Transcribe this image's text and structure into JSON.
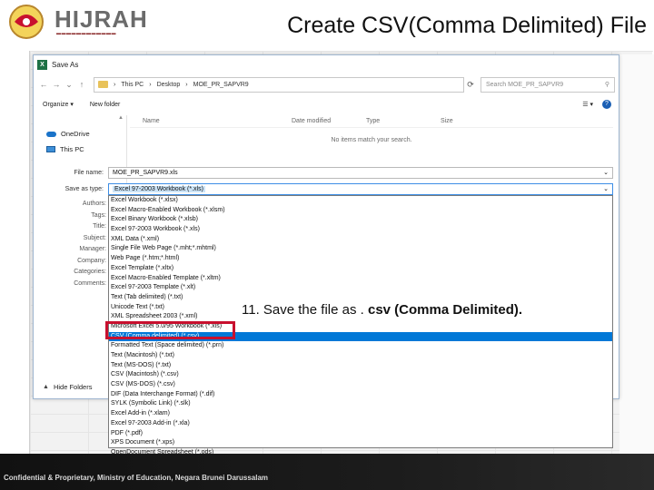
{
  "slide": {
    "title": "Create CSV(Comma Delimited) File",
    "logo_text": "HIJRAH",
    "footer": "Confidential & Proprietary, Ministry of Education, Negara Brunei Darussalam",
    "callout_prefix": "11. Save the file as . ",
    "callout_bold": "csv (Comma Delimited)."
  },
  "dialog": {
    "title": "Save As",
    "breadcrumb": [
      "This PC",
      "Desktop",
      "MOE_PR_SAPVR9"
    ],
    "search_placeholder": "Search MOE_PR_SAPVR9",
    "toolbar": {
      "organize": "Organize",
      "new_folder": "New folder"
    },
    "nav_items": [
      "OneDrive",
      "This PC"
    ],
    "columns": [
      "Name",
      "Date modified",
      "Type",
      "Size"
    ],
    "empty_message": "No items match your search.",
    "file_name_label": "File name:",
    "file_name_value": "MOE_PR_SAPVR9.xls",
    "save_type_label": "Save as type:",
    "save_type_value": "Excel 97-2003 Workbook (*.xls)",
    "meta_labels": [
      "Authors:",
      "Tags:",
      "Title:",
      "Subject:",
      "Manager:",
      "Company:",
      "Categories:",
      "Comments:"
    ],
    "hide_folders": "Hide Folders"
  },
  "dropdown_options": [
    "Excel Workbook (*.xlsx)",
    "Excel Macro-Enabled Workbook (*.xlsm)",
    "Excel Binary Workbook (*.xlsb)",
    "Excel 97-2003 Workbook (*.xls)",
    "XML Data (*.xml)",
    "Single File Web Page (*.mht;*.mhtml)",
    "Web Page (*.htm;*.html)",
    "Excel Template (*.xltx)",
    "Excel Macro-Enabled Template (*.xltm)",
    "Excel 97-2003 Template (*.xlt)",
    "Text (Tab delimited) (*.txt)",
    "Unicode Text (*.txt)",
    "XML Spreadsheet 2003 (*.xml)",
    "Microsoft Excel 5.0/95 Workbook (*.xls)",
    "CSV (Comma delimited) (*.csv)",
    "Formatted Text (Space delimited) (*.prn)",
    "Text (Macintosh) (*.txt)",
    "Text (MS-DOS) (*.txt)",
    "CSV (Macintosh) (*.csv)",
    "CSV (MS-DOS) (*.csv)",
    "DIF (Data Interchange Format) (*.dif)",
    "SYLK (Symbolic Link) (*.slk)",
    "Excel Add-in (*.xlam)",
    "Excel 97-2003 Add-in (*.xla)",
    "PDF (*.pdf)",
    "XPS Document (*.xps)",
    "OpenDocument Spreadsheet (*.ods)"
  ],
  "highlighted_option_index": 14,
  "colors": {
    "highlight": "#0078d7",
    "callout_box": "#c8102e",
    "footer_bg": "#111111"
  }
}
